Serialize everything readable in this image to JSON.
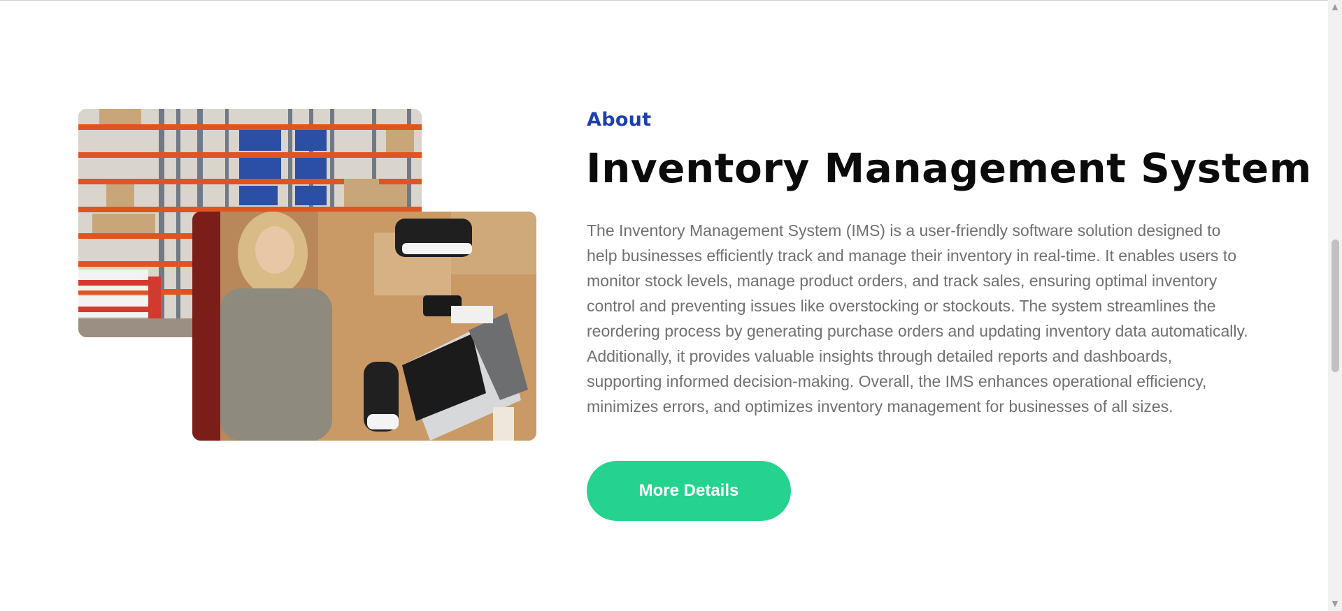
{
  "about": {
    "eyebrow": "About",
    "title": "Inventory Management System",
    "description": "The Inventory Management System (IMS) is a user-friendly software solution designed to help businesses efficiently track and manage their inventory in real-time. It enables users to monitor stock levels, manage product orders, and track sales, ensuring optimal inventory control and preventing issues like overstocking or stockouts. The system streamlines the reordering process by generating purchase orders and updating inventory data automatically. Additionally, it provides valuable insights through detailed reports and dashboards, supporting informed decision-making. Overall, the IMS enhances operational efficiency, minimizes errors, and optimizes inventory management for businesses of all sizes.",
    "cta_label": "More Details"
  },
  "images": {
    "back": "warehouse-shelves-photo",
    "front": "person-packing-order-with-laptop-photo"
  },
  "colors": {
    "eyebrow": "#1e40af",
    "title": "#0b0b0b",
    "body_text": "#707070",
    "cta_background": "#26d38e",
    "cta_text": "#ffffff"
  },
  "scrollbar": {
    "up_icon": "arrow-up-icon",
    "down_icon": "arrow-down-icon"
  }
}
